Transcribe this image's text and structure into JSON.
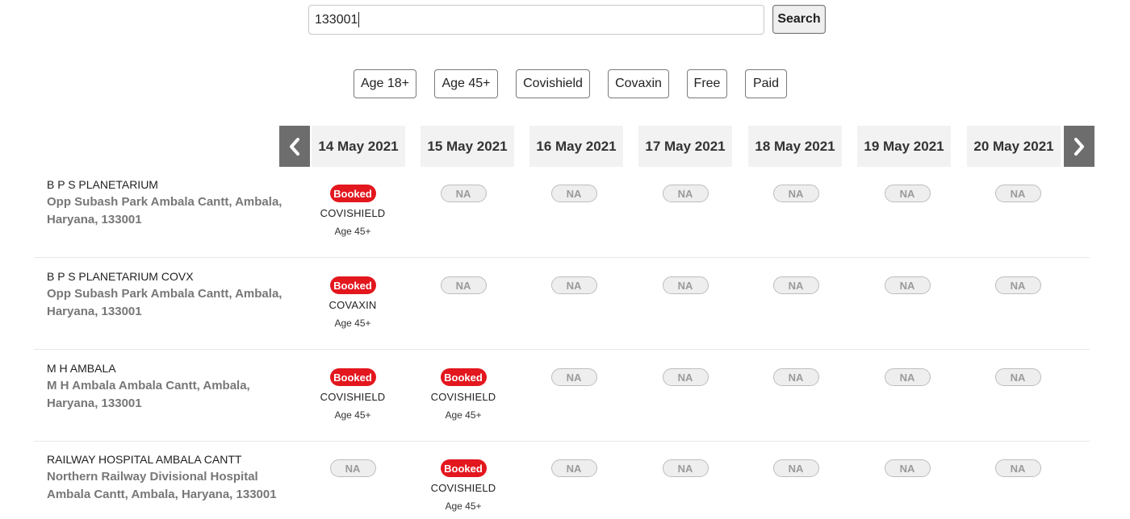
{
  "search": {
    "value": "133001",
    "button_label": "Search"
  },
  "filters": [
    "Age 18+",
    "Age 45+",
    "Covishield",
    "Covaxin",
    "Free",
    "Paid"
  ],
  "dates": [
    "14 May 2021",
    "15 May 2021",
    "16 May 2021",
    "17 May 2021",
    "18 May 2021",
    "19 May 2021",
    "20 May 2021"
  ],
  "icons": {
    "prev": "chevron-left-icon",
    "next": "chevron-right-icon"
  },
  "colors": {
    "booked": "#e3171e",
    "nav": "#6d6d6d"
  },
  "centers": [
    {
      "name": "B P S PLANETARIUM",
      "address_line1": "Opp Subash Park Ambala Cantt, Ambala,",
      "address_line2": "Haryana, 133001",
      "slots": [
        {
          "status": "Booked",
          "vaccine": "COVISHIELD",
          "age": "Age 45+"
        },
        {
          "status": "NA"
        },
        {
          "status": "NA"
        },
        {
          "status": "NA"
        },
        {
          "status": "NA"
        },
        {
          "status": "NA"
        },
        {
          "status": "NA"
        }
      ]
    },
    {
      "name": "B P S PLANETARIUM COVX",
      "address_line1": "Opp Subash Park Ambala Cantt, Ambala,",
      "address_line2": "Haryana, 133001",
      "slots": [
        {
          "status": "Booked",
          "vaccine": "COVAXIN",
          "age": "Age 45+"
        },
        {
          "status": "NA"
        },
        {
          "status": "NA"
        },
        {
          "status": "NA"
        },
        {
          "status": "NA"
        },
        {
          "status": "NA"
        },
        {
          "status": "NA"
        }
      ]
    },
    {
      "name": "M H AMBALA",
      "address_line1": "M H Ambala Ambala Cantt, Ambala,",
      "address_line2": "Haryana, 133001",
      "slots": [
        {
          "status": "Booked",
          "vaccine": "COVISHIELD",
          "age": "Age 45+"
        },
        {
          "status": "Booked",
          "vaccine": "COVISHIELD",
          "age": "Age 45+"
        },
        {
          "status": "NA"
        },
        {
          "status": "NA"
        },
        {
          "status": "NA"
        },
        {
          "status": "NA"
        },
        {
          "status": "NA"
        }
      ]
    },
    {
      "name": "RAILWAY HOSPITAL AMBALA CANTT",
      "address_line1": "Northern Railway Divisional Hospital",
      "address_line2": "Ambala Cantt, Ambala, Haryana, 133001",
      "slots": [
        {
          "status": "NA"
        },
        {
          "status": "Booked",
          "vaccine": "COVISHIELD",
          "age": "Age 45+"
        },
        {
          "status": "NA"
        },
        {
          "status": "NA"
        },
        {
          "status": "NA"
        },
        {
          "status": "NA"
        },
        {
          "status": "NA"
        }
      ]
    }
  ]
}
